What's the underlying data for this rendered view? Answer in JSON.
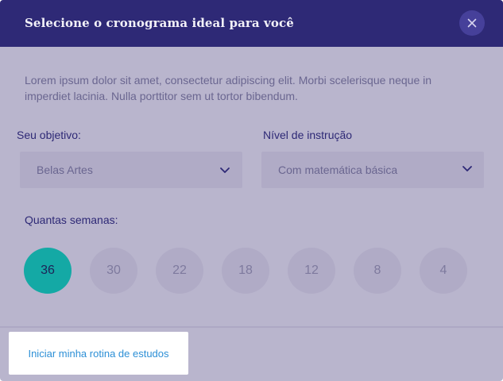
{
  "modal": {
    "title": "Selecione o cronograma ideal para você",
    "close_icon": "close-icon",
    "description": "Lorem ipsum dolor sit amet, consectetur adipiscing elit. Morbi scelerisque neque in imperdiet lacinia. Nulla porttitor sem ut tortor bibendum."
  },
  "form": {
    "objective": {
      "label": "Seu objetivo:",
      "value": "Belas Artes",
      "icon": "chevron-down-icon"
    },
    "level": {
      "label": "Nível de instrução",
      "value": "Com matemática básica",
      "icon": "chevron-down-icon"
    },
    "weeks": {
      "label": "Quantas semanas:",
      "options": [
        "36",
        "30",
        "22",
        "18",
        "12",
        "8",
        "4"
      ],
      "selected": "36"
    }
  },
  "footer": {
    "start_label": "Iniciar minha rotina de estudos"
  },
  "colors": {
    "header": "#2e2976",
    "overlay": "#b9b5cd",
    "accent": "#14a9a5",
    "link": "#2c8fd6"
  }
}
